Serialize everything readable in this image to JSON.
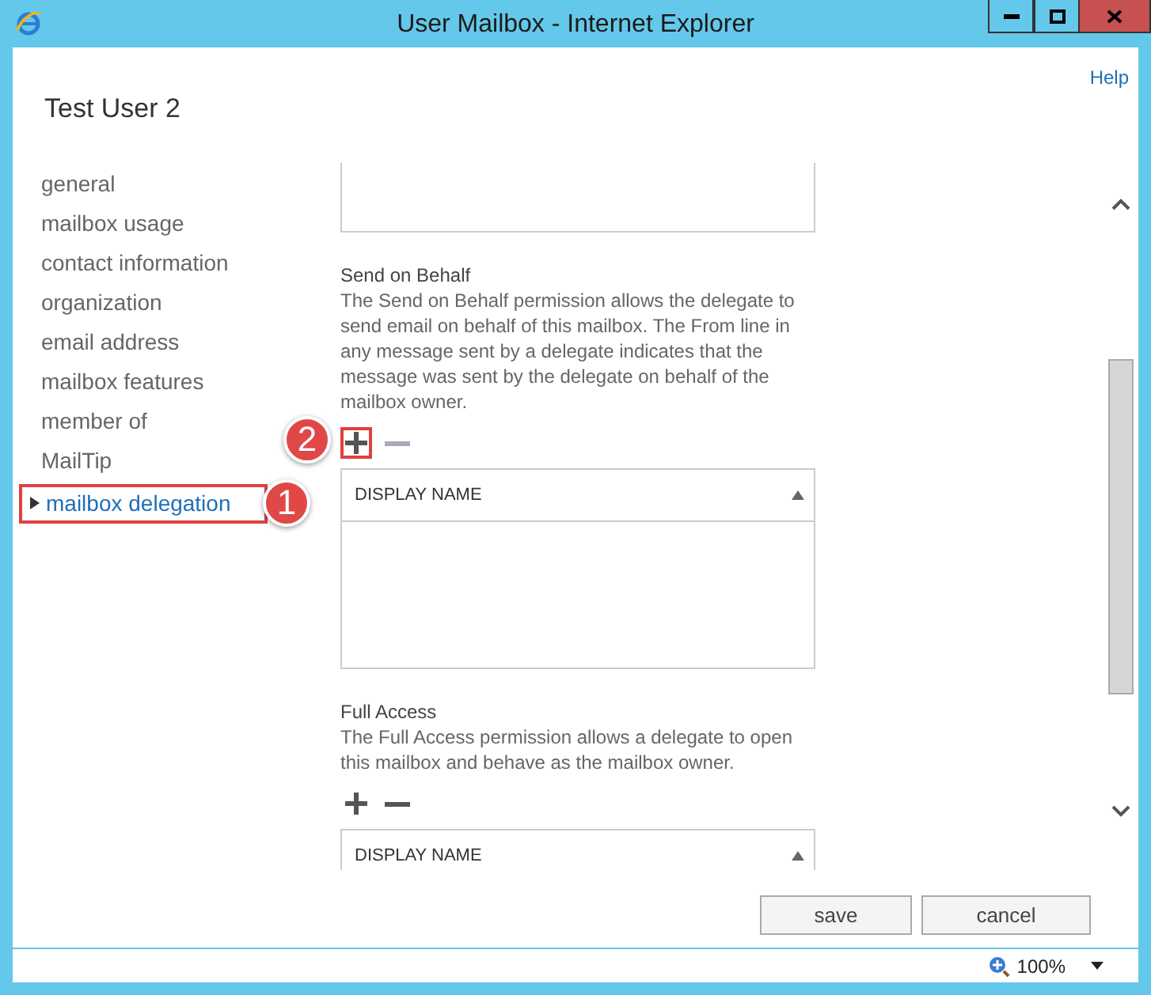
{
  "window": {
    "title": "User Mailbox - Internet Explorer"
  },
  "help_link": "Help",
  "page_title": "Test User 2",
  "nav": [
    {
      "label": "general",
      "selected": false
    },
    {
      "label": "mailbox usage",
      "selected": false
    },
    {
      "label": "contact information",
      "selected": false
    },
    {
      "label": "organization",
      "selected": false
    },
    {
      "label": "email address",
      "selected": false
    },
    {
      "label": "mailbox features",
      "selected": false
    },
    {
      "label": "member of",
      "selected": false
    },
    {
      "label": "MailTip",
      "selected": false
    },
    {
      "label": "mailbox delegation",
      "selected": true,
      "callout": "1"
    }
  ],
  "sections": [
    {
      "title": "Send on Behalf",
      "description": "The Send on Behalf permission allows the delegate to send email on behalf of this mailbox. The From line in any message sent by a delegate indicates that the message was sent by the delegate on behalf of the mailbox owner.",
      "add_callout": "2",
      "column": "DISPLAY NAME"
    },
    {
      "title": "Full Access",
      "description": "The Full Access permission allows a delegate to open this mailbox and behave as the mailbox owner.",
      "column": "DISPLAY NAME"
    }
  ],
  "buttons": [
    "save",
    "cancel"
  ],
  "status_bar": {
    "zoom": "100%"
  }
}
